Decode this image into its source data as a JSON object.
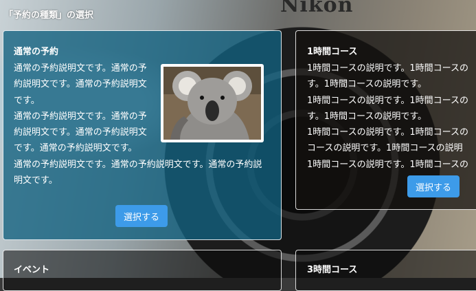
{
  "section": {
    "title": "「予約の種類」の選択"
  },
  "background": {
    "brand_text": "Nikon"
  },
  "cards": {
    "regular": {
      "title": "通常の予約",
      "paragraphs": [
        "通常の予約説明文です。通常の予約説明文です。通常の予約説明文です。",
        "通常の予約説明文です。通常の予約説明文です。通常の予約説明文です。通常の予約説明文です。",
        "通常の予約説明文です。通常の予約説明文です。通常の予約説明文です。"
      ],
      "image_alt": "コアラ",
      "button_label": "選択する"
    },
    "one_hour": {
      "title": "1時間コース",
      "lines": [
        "1時間コースの説明です。1時間コースの",
        "す。1時間コースの説明です。",
        "1時間コースの説明です。1時間コースの",
        "す。1時間コースの説明です。",
        "1時間コースの説明です。1時間コースの",
        "コースの説明です。1時間コースの説明",
        "1時間コースの説明です。1時間コースの"
      ],
      "button_label": "選択する"
    },
    "event": {
      "title": "イベント"
    },
    "three_hour": {
      "title": "3時間コース"
    }
  },
  "colors": {
    "button": "#3d9be9",
    "regular_card": "#126280"
  }
}
